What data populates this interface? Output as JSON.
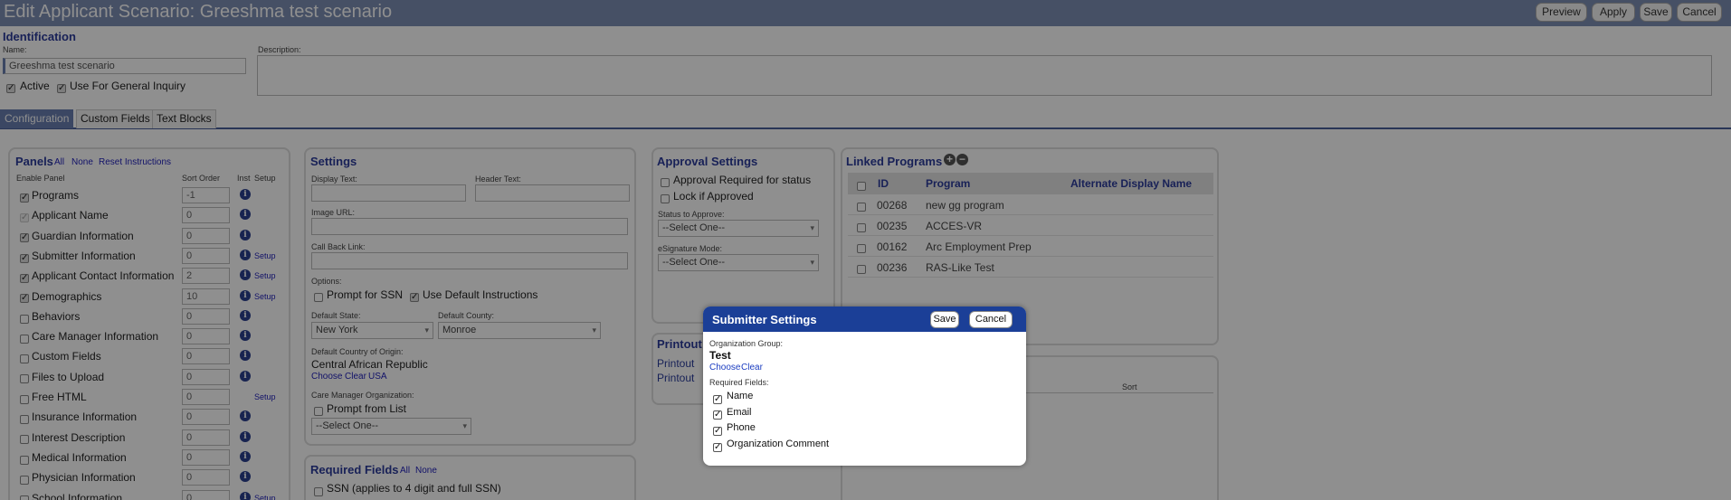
{
  "page": {
    "title": "Edit Applicant Scenario: Greeshma test scenario",
    "buttons": {
      "preview": "Preview",
      "apply": "Apply",
      "save": "Save",
      "cancel": "Cancel"
    }
  },
  "identification": {
    "heading": "Identification",
    "name_label": "Name:",
    "name_value": "Greeshma test scenario",
    "description_label": "Description:",
    "active_label": "Active",
    "active_checked": true,
    "general_inquiry_label": "Use For General Inquiry",
    "general_inquiry_checked": true
  },
  "tabs": [
    {
      "label": "Configuration",
      "active": true
    },
    {
      "label": "Custom Fields",
      "active": false
    },
    {
      "label": "Text Blocks",
      "active": false
    }
  ],
  "panels": {
    "heading": "Panels",
    "links": {
      "all": "All",
      "none": "None",
      "reset": "Reset Instructions"
    },
    "columns": {
      "enable": "Enable Panel",
      "sort": "Sort Order",
      "inst": "Inst",
      "setup": "Setup"
    },
    "rows": [
      {
        "label": "Programs",
        "checked": true,
        "sort": "-1",
        "info": true,
        "setup": ""
      },
      {
        "label": "Applicant Name",
        "checked": true,
        "sort": "0",
        "info": true,
        "setup": ""
      },
      {
        "label": "Guardian Information",
        "checked": true,
        "sort": "0",
        "info": true,
        "setup": ""
      },
      {
        "label": "Submitter Information",
        "checked": true,
        "sort": "0",
        "info": true,
        "setup": "Setup"
      },
      {
        "label": "Applicant Contact Information",
        "checked": true,
        "sort": "2",
        "info": true,
        "setup": "Setup"
      },
      {
        "label": "Demographics",
        "checked": true,
        "sort": "10",
        "info": true,
        "setup": "Setup"
      },
      {
        "label": "Behaviors",
        "checked": false,
        "sort": "0",
        "info": true,
        "setup": ""
      },
      {
        "label": "Care Manager Information",
        "checked": false,
        "sort": "0",
        "info": true,
        "setup": ""
      },
      {
        "label": "Custom Fields",
        "checked": false,
        "sort": "0",
        "info": true,
        "setup": ""
      },
      {
        "label": "Files to Upload",
        "checked": false,
        "sort": "0",
        "info": true,
        "setup": ""
      },
      {
        "label": "Free HTML",
        "checked": false,
        "sort": "0",
        "info": false,
        "setup": "Setup"
      },
      {
        "label": "Insurance Information",
        "checked": false,
        "sort": "0",
        "info": true,
        "setup": ""
      },
      {
        "label": "Interest Description",
        "checked": false,
        "sort": "0",
        "info": true,
        "setup": ""
      },
      {
        "label": "Medical Information",
        "checked": false,
        "sort": "0",
        "info": true,
        "setup": ""
      },
      {
        "label": "Physician Information",
        "checked": false,
        "sort": "0",
        "info": true,
        "setup": ""
      },
      {
        "label": "School Information",
        "checked": false,
        "sort": "0",
        "info": true,
        "setup": "Setup"
      }
    ]
  },
  "settings": {
    "heading": "Settings",
    "display_text_label": "Display Text:",
    "header_text_label": "Header Text:",
    "image_url_label": "Image URL:",
    "callback_label": "Call Back Link:",
    "options_label": "Options:",
    "prompt_ssn_label": "Prompt for SSN",
    "use_default_instr_label": "Use Default Instructions",
    "default_state_label": "Default State:",
    "default_state_value": "New York",
    "default_county_label": "Default County:",
    "default_county_value": "Monroe",
    "default_country_label": "Default Country of Origin:",
    "default_country_value": "Central African Republic",
    "country_links": {
      "choose": "Choose",
      "clear": "Clear",
      "usa": "USA"
    },
    "care_manager_org_label": "Care Manager Organization:",
    "prompt_list_label": "Prompt from List",
    "care_manager_select": "--Select One--"
  },
  "required_fields": {
    "heading": "Required Fields",
    "all": "All",
    "none": "None",
    "ssn_label": "SSN (applies to 4 digit and full SSN)"
  },
  "approval": {
    "heading": "Approval Settings",
    "approval_required_label": "Approval Required for status",
    "lock_label": "Lock if Approved",
    "status_label": "Status to Approve:",
    "status_value": "--Select One--",
    "esign_label": "eSignature Mode:",
    "esign_value": "--Select One--"
  },
  "printouts": {
    "heading": "Printout",
    "link1": "Printout",
    "link2": "Printout"
  },
  "linked_programs": {
    "heading": "Linked Programs",
    "columns": {
      "id": "ID",
      "program": "Program",
      "alt": "Alternate Display Name"
    },
    "rows": [
      {
        "id": "00268",
        "program": "new gg program",
        "alt": ""
      },
      {
        "id": "00235",
        "program": "ACCES-VR",
        "alt": ""
      },
      {
        "id": "00162",
        "program": "Arc Employment Prep",
        "alt": ""
      },
      {
        "id": "00236",
        "program": "RAS-Like Test",
        "alt": ""
      }
    ]
  },
  "lower_right": {
    "sort_label": "Sort"
  },
  "modal": {
    "title": "Submitter Settings",
    "save": "Save",
    "cancel": "Cancel",
    "org_group_label": "Organization Group:",
    "org_group_value": "Test",
    "choose": "Choose",
    "clear": "Clear",
    "required_label": "Required Fields:",
    "fields": [
      {
        "label": "Name",
        "checked": true
      },
      {
        "label": "Email",
        "checked": true
      },
      {
        "label": "Phone",
        "checked": true
      },
      {
        "label": "Organization Comment",
        "checked": true
      }
    ]
  }
}
